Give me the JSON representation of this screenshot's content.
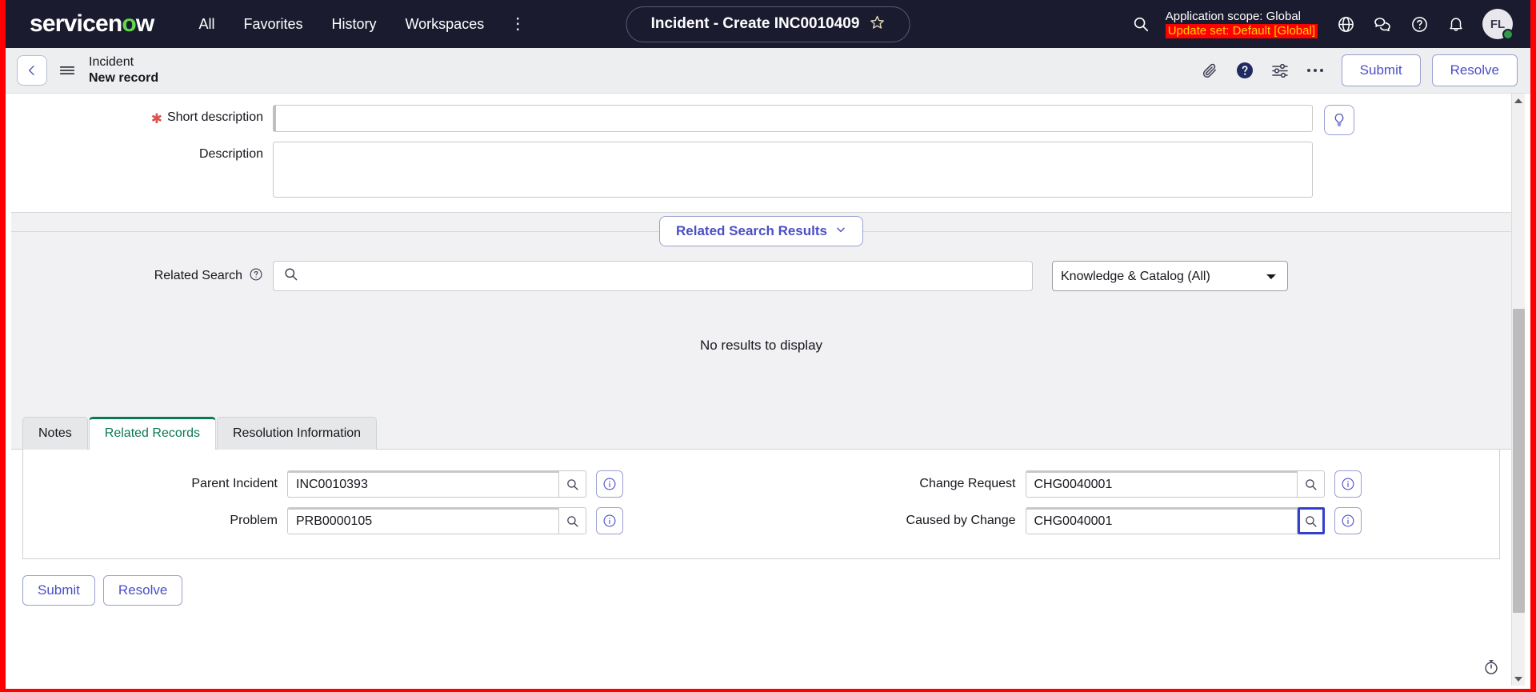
{
  "topnav": {
    "logo_text": "servicenow",
    "links": [
      {
        "label": "All"
      },
      {
        "label": "Favorites"
      },
      {
        "label": "History"
      },
      {
        "label": "Workspaces"
      }
    ],
    "kebab": "⋮",
    "title_pill": {
      "text": "Incident - Create INC0010409",
      "star_icon": "star-icon"
    },
    "search_icon": "search-icon",
    "scope": {
      "line1": "Application scope: Global",
      "line2": "Update set: Default [Global]",
      "line2_bg": "#ff0000",
      "line2_color": "#ffd400"
    },
    "icons": [
      {
        "name": "globe-icon"
      },
      {
        "name": "conversations-icon"
      },
      {
        "name": "help-circle-icon"
      },
      {
        "name": "bell-icon"
      }
    ],
    "avatar": {
      "initials": "FL",
      "status": "online",
      "status_color": "#2e9b46"
    },
    "bg_color": "#1b1b2f"
  },
  "toolbar": {
    "back_icon": "chevron-left-icon",
    "menu_icon": "hamburger-icon",
    "record_type": "Incident",
    "record_state": "New record",
    "icons": [
      {
        "name": "attachment-icon"
      },
      {
        "name": "help-filled-icon"
      },
      {
        "name": "personalize-form-icon"
      },
      {
        "name": "more-actions-icon"
      }
    ],
    "submit_label": "Submit",
    "resolve_label": "Resolve"
  },
  "form": {
    "short_description": {
      "label": "Short description",
      "mandatory": true,
      "value": "",
      "placeholder": ""
    },
    "description": {
      "label": "Description",
      "value": "",
      "placeholder": ""
    },
    "suggestion_icon": "lightbulb-icon"
  },
  "related_search_results": {
    "section_label": "Related Search Results",
    "chevron_icon": "chevron-down-icon",
    "search_label": "Related Search",
    "help_icon": "help-circle-outline-icon",
    "search_icon": "search-icon",
    "search_value": "",
    "search_placeholder": "",
    "filter_selected": "Knowledge & Catalog (All)",
    "filter_options": [
      "Knowledge & Catalog (All)"
    ],
    "empty_message": "No results to display"
  },
  "tabs": [
    {
      "label": "Notes",
      "active": false
    },
    {
      "label": "Related Records",
      "active": true
    },
    {
      "label": "Resolution Information",
      "active": false
    }
  ],
  "active_tab_color": "#0b7a50",
  "related_records": {
    "left": [
      {
        "label": "Parent Incident",
        "value": "INC0010393",
        "lookup_icon": "magnifier-icon",
        "info_icon": "info-circle-icon",
        "focused": false
      },
      {
        "label": "Problem",
        "value": "PRB0000105",
        "lookup_icon": "magnifier-icon",
        "info_icon": "info-circle-icon",
        "focused": false
      }
    ],
    "right": [
      {
        "label": "Change Request",
        "value": "CHG0040001",
        "lookup_icon": "magnifier-icon",
        "info_icon": "info-circle-icon",
        "focused": false
      },
      {
        "label": "Caused by Change",
        "value": "CHG0040001",
        "lookup_icon": "magnifier-icon",
        "info_icon": "info-circle-icon",
        "focused": true
      }
    ],
    "focus_ring_color": "#3340c9"
  },
  "bottom_actions": {
    "submit_label": "Submit",
    "resolve_label": "Resolve"
  },
  "status_bar": {
    "timer_icon": "stopwatch-icon"
  },
  "scrollbar": {
    "up_icon": "triangle-up-icon",
    "down_icon": "triangle-down-icon"
  }
}
